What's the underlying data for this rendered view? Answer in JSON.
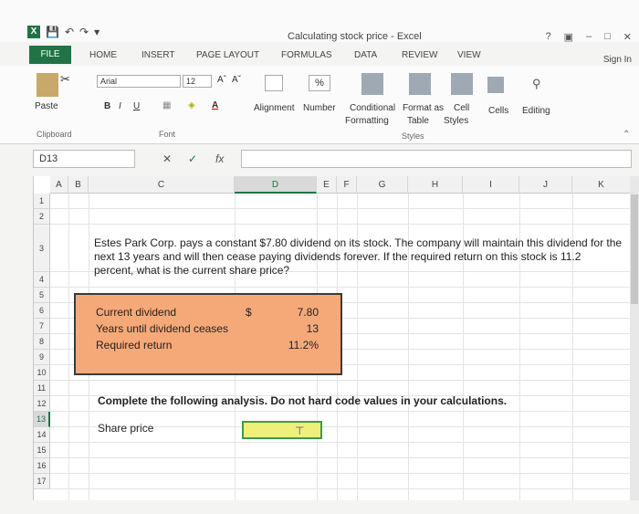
{
  "window": {
    "title": "Calculating stock price - Excel",
    "help": "?",
    "minimize": "–",
    "restore": "□",
    "close": "✕"
  },
  "tabs": {
    "file": "FILE",
    "home": "HOME",
    "insert": "INSERT",
    "page_layout": "PAGE LAYOUT",
    "formulas": "FORMULAS",
    "data": "DATA",
    "review": "REVIEW",
    "view": "VIEW",
    "sign_in": "Sign In"
  },
  "ribbon": {
    "paste": "Paste",
    "clipboard": "Clipboard",
    "font_name": "Arial",
    "font_size": "12",
    "bold": "B",
    "italic": "I",
    "underline": "U",
    "font_group": "Font",
    "alignment": "Alignment",
    "number": "Number",
    "percent": "%",
    "conditional_formatting_1": "Conditional",
    "conditional_formatting_2": "Formatting",
    "format_as_table_1": "Format as",
    "format_as_table_2": "Table",
    "cell_styles_1": "Cell",
    "cell_styles_2": "Styles",
    "styles_group": "Styles",
    "cells": "Cells",
    "editing": "Editing"
  },
  "formula_bar": {
    "name_box": "D13",
    "cancel": "✕",
    "enter": "✓",
    "fx": "fx",
    "content": ""
  },
  "columns": [
    "A",
    "B",
    "C",
    "D",
    "E",
    "F",
    "G",
    "H",
    "I",
    "J",
    "K"
  ],
  "rows": [
    "1",
    "2",
    "3",
    "4",
    "5",
    "6",
    "7",
    "8",
    "9",
    "10",
    "11",
    "12",
    "13",
    "14",
    "15",
    "16",
    "17"
  ],
  "active_cell": {
    "column": "D",
    "row": "13"
  },
  "sheet": {
    "problem": "Estes Park Corp. pays a constant $7.80 dividend on its stock. The company will maintain this dividend for the next 13 years and will then cease paying dividends forever. If the required return on this stock is 11.2 percent, what is the current share price?",
    "inputs": [
      {
        "label": "Current dividend",
        "currency": "$",
        "value": "7.80"
      },
      {
        "label": "Years until dividend ceases",
        "currency": "",
        "value": "13"
      },
      {
        "label": "Required return",
        "currency": "",
        "value": "11.2%"
      }
    ],
    "instruction": "Complete the following analysis. Do not hard code values in your calculations.",
    "share_price_label": "Share price",
    "share_price_value": ""
  },
  "colors": {
    "excel_green": "#217346",
    "input_box_fill": "#f6a978",
    "answer_fill": "#eef07a",
    "answer_border": "#3b9b4a"
  }
}
